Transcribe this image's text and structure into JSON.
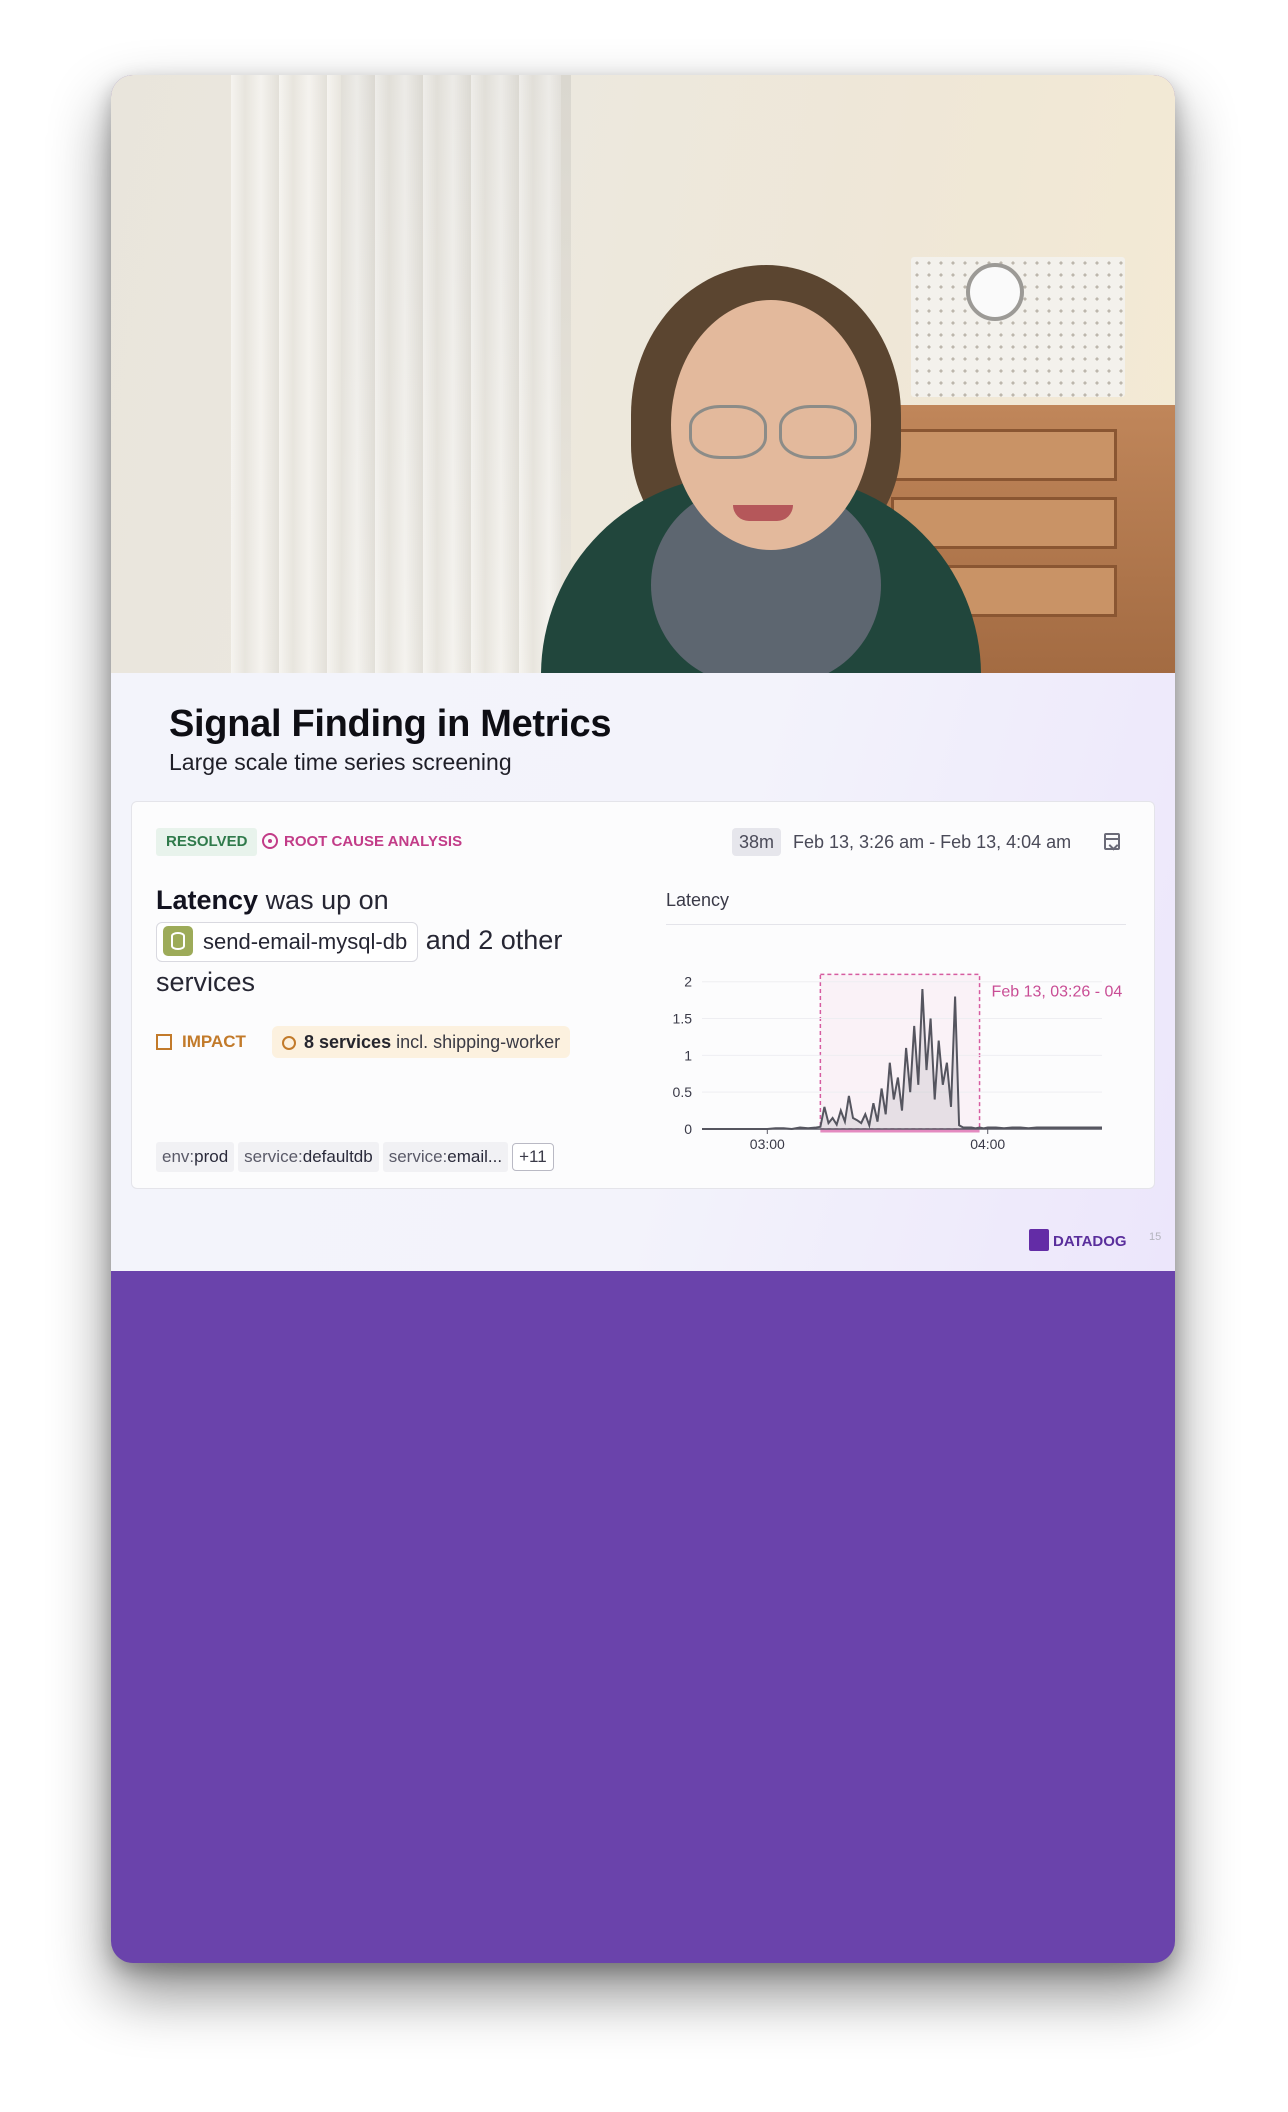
{
  "slide": {
    "title": "Signal Finding in Metrics",
    "subtitle": "Large scale time series screening",
    "page_number": "15",
    "logo_text": "DATADOG"
  },
  "card": {
    "status_badge": "RESOLVED",
    "category": "ROOT CAUSE ANALYSIS",
    "duration": "38m",
    "time_range": "Feb 13, 3:26 am - Feb 13, 4:04 am",
    "summary": {
      "metric": "Latency",
      "pre": "was up on",
      "service": "send-email-mysql-db",
      "post": "and 2 other services"
    },
    "impact_label": "IMPACT",
    "impact_count": "8 services",
    "impact_rest": "incl. shipping-worker",
    "tags": [
      {
        "key": "env:",
        "value": "prod"
      },
      {
        "key": "service:",
        "value": "defaultdb"
      },
      {
        "key": "service:",
        "value": "email..."
      }
    ],
    "tags_more": "+11"
  },
  "chart_data": {
    "type": "line",
    "title": "Latency",
    "xlabel": "",
    "ylabel": "",
    "ylim": [
      0,
      2.2
    ],
    "yticks": [
      "0",
      "0.5",
      "1",
      "1.5",
      "2"
    ],
    "xticks": [
      "03:00",
      "04:00"
    ],
    "highlight_label": "Feb 13, 03:26 - 04",
    "grid": true,
    "series": [
      {
        "x": [
          0,
          2,
          4,
          6,
          8,
          10,
          12,
          14,
          16,
          18,
          20,
          22,
          24,
          26,
          28,
          29,
          30,
          31,
          32,
          33,
          34,
          35,
          36,
          37,
          38,
          39,
          40,
          41,
          42,
          43,
          44,
          45,
          46,
          47,
          48,
          49,
          50,
          51,
          52,
          53,
          54,
          55,
          56,
          57,
          58,
          59,
          60,
          61,
          62,
          63,
          64,
          65,
          66,
          67,
          68,
          69,
          70,
          72,
          74,
          76,
          78,
          80,
          82,
          84,
          86,
          88,
          90,
          92,
          94,
          96,
          98
        ],
        "y": [
          0,
          0,
          0,
          0,
          0,
          0,
          0,
          0,
          0,
          0.01,
          0.01,
          0,
          0.02,
          0.01,
          0.02,
          0.03,
          0.3,
          0.08,
          0.15,
          0.06,
          0.25,
          0.1,
          0.45,
          0.15,
          0.12,
          0.08,
          0.2,
          0.05,
          0.35,
          0.1,
          0.55,
          0.2,
          0.9,
          0.4,
          0.7,
          0.25,
          1.1,
          0.5,
          1.4,
          0.6,
          1.9,
          0.8,
          1.5,
          0.4,
          1.2,
          0.6,
          0.9,
          0.3,
          1.8,
          0.05,
          0.02,
          0.02,
          0.02,
          0.01,
          0.02,
          0.01,
          0.02,
          0.02,
          0.01,
          0.02,
          0.02,
          0.01,
          0.02,
          0.02,
          0.02,
          0.02,
          0.02,
          0.02,
          0.02,
          0.02,
          0.02
        ]
      }
    ]
  }
}
